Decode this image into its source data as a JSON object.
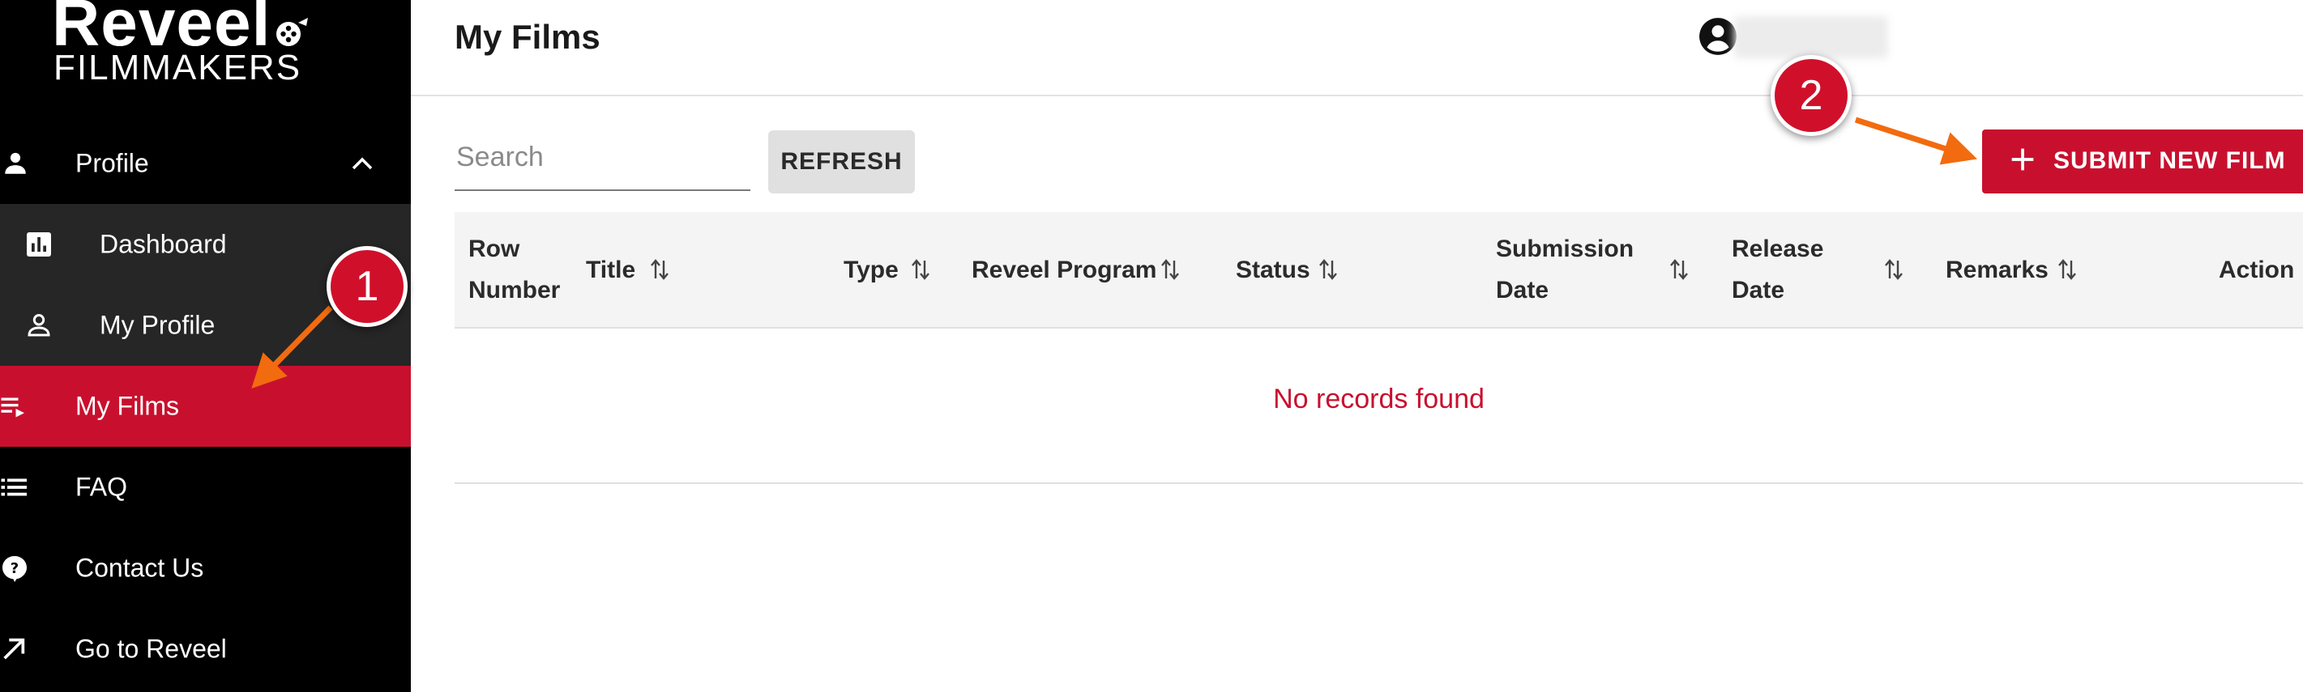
{
  "brand": {
    "word": "Reveel",
    "sub": "FILMMAKERS"
  },
  "sidebar": {
    "items": [
      {
        "key": "profile",
        "label": "Profile",
        "icon": "person-icon",
        "expanded": true
      },
      {
        "key": "dashboard",
        "label": "Dashboard",
        "icon": "bar-chart-icon"
      },
      {
        "key": "my-profile",
        "label": "My Profile",
        "icon": "person-outline-icon"
      },
      {
        "key": "my-films",
        "label": "My Films",
        "icon": "playlist-play-icon",
        "active": true
      },
      {
        "key": "faq",
        "label": "FAQ",
        "icon": "list-icon"
      },
      {
        "key": "contact",
        "label": "Contact Us",
        "icon": "help-icon"
      },
      {
        "key": "go-reveel",
        "label": "Go to Reveel",
        "icon": "arrow-up-right-icon"
      }
    ]
  },
  "header": {
    "title": "My Films",
    "account_icon": "account-circle-icon"
  },
  "toolbar": {
    "search_placeholder": "Search",
    "refresh_label": "REFRESH",
    "submit_label": "SUBMIT NEW FILM"
  },
  "table": {
    "columns": [
      {
        "line1": "Row",
        "line2": "Number",
        "sortable": false
      },
      {
        "line1": "Title",
        "line2": "",
        "sortable": true
      },
      {
        "line1": "Type",
        "line2": "",
        "sortable": true
      },
      {
        "line1": "Reveel Program",
        "line2": "",
        "sortable": true
      },
      {
        "line1": "Status",
        "line2": "",
        "sortable": true
      },
      {
        "line1": "Submission",
        "line2": "Date",
        "sortable": true
      },
      {
        "line1": "Release",
        "line2": "Date",
        "sortable": true
      },
      {
        "line1": "Remarks",
        "line2": "",
        "sortable": true
      },
      {
        "line1": "Action",
        "line2": "",
        "sortable": false
      }
    ],
    "empty_message": "No records found"
  },
  "annotations": [
    {
      "number": "1"
    },
    {
      "number": "2"
    }
  ],
  "colors": {
    "accent": "#c8102e",
    "sidebar_bg": "#000000",
    "sidebar_sub_bg": "#262626",
    "arrow": "#f26b0f",
    "badge": "#d0102a"
  }
}
